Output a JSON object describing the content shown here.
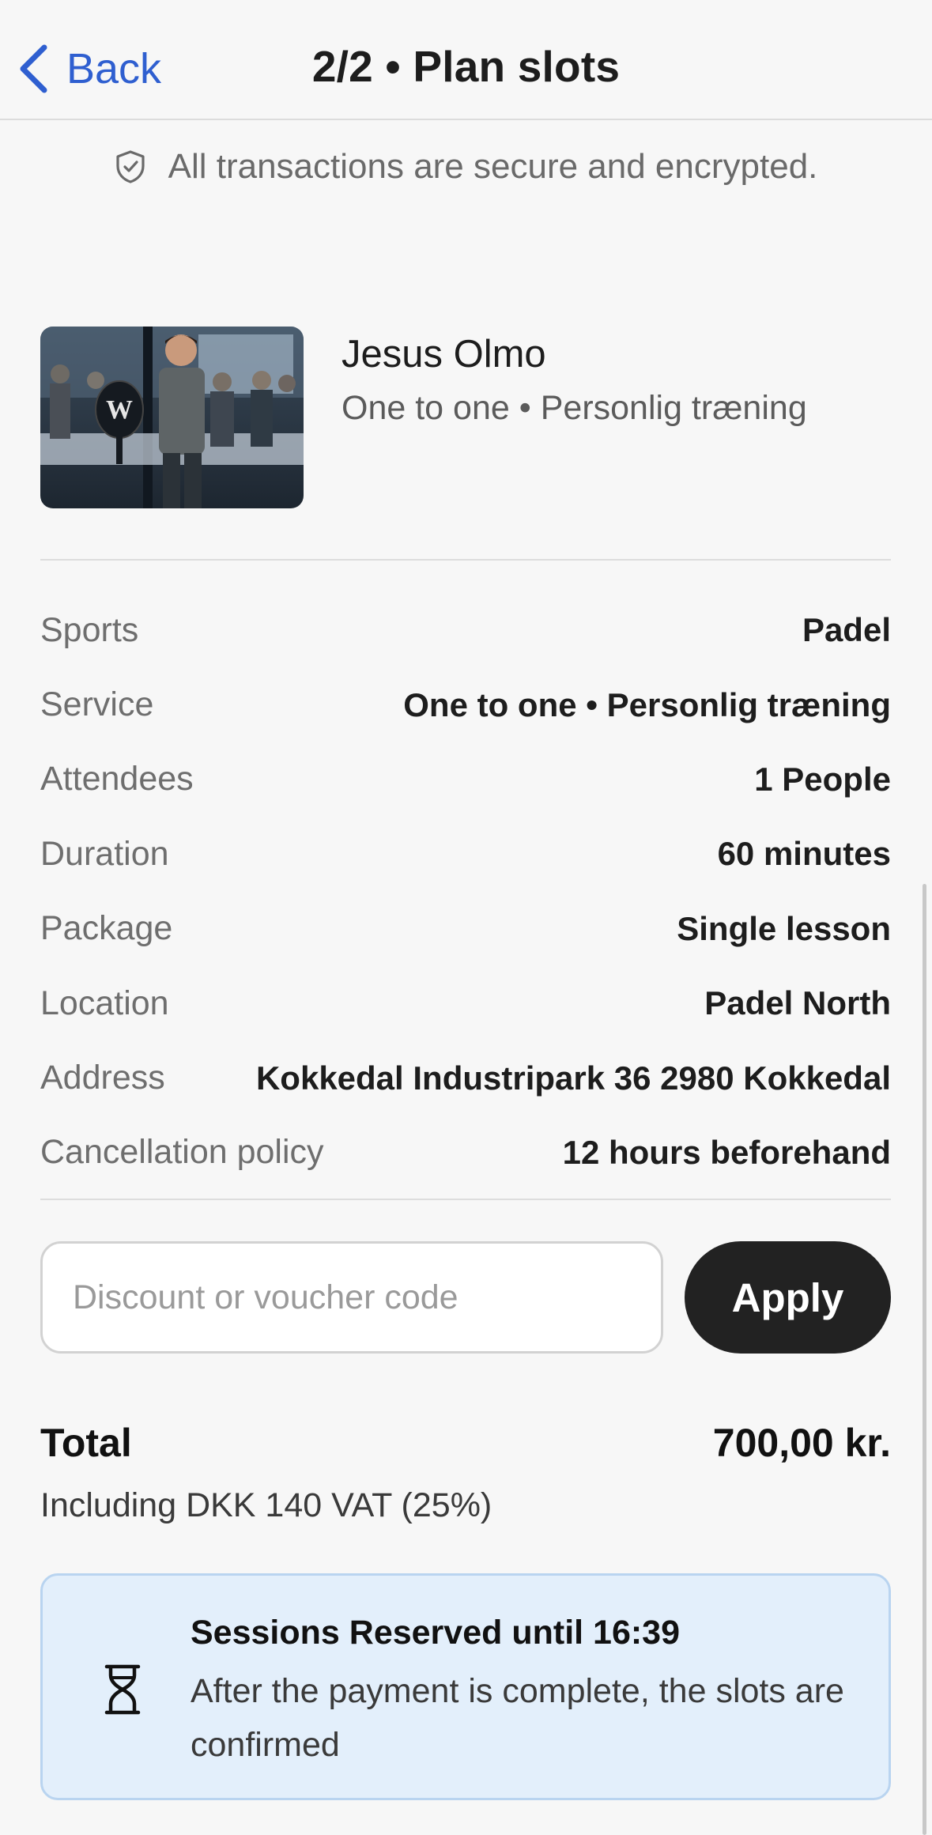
{
  "header": {
    "back_label": "Back",
    "title": "2/2 • Plan slots"
  },
  "secure_notice": "All transactions are secure and encrypted.",
  "coach": {
    "name": "Jesus Olmo",
    "subtitle": "One to one • Personlig træning"
  },
  "details": [
    {
      "label": "Sports",
      "value": "Padel"
    },
    {
      "label": "Service",
      "value": "One to one • Personlig træning"
    },
    {
      "label": "Attendees",
      "value": "1 People"
    },
    {
      "label": "Duration",
      "value": "60 minutes"
    },
    {
      "label": "Package",
      "value": "Single lesson"
    },
    {
      "label": "Location",
      "value": "Padel North"
    },
    {
      "label": "Address",
      "value": "Kokkedal Industripark 36 2980 Kokkedal"
    },
    {
      "label": "Cancellation policy",
      "value": "12 hours beforehand"
    }
  ],
  "voucher": {
    "placeholder": "Discount or voucher code",
    "value": "",
    "apply_label": "Apply"
  },
  "total": {
    "label": "Total",
    "value": "700,00 kr.",
    "vat_note": "Including DKK 140 VAT (25%)"
  },
  "reservation": {
    "title": "Sessions Reserved until 16:39",
    "body": "After the payment is complete, the slots are confirmed"
  },
  "colors": {
    "accent": "#2f5fd0",
    "button_dark": "#222222",
    "info_bg": "#e3effb",
    "info_border": "#b9d4f0"
  }
}
